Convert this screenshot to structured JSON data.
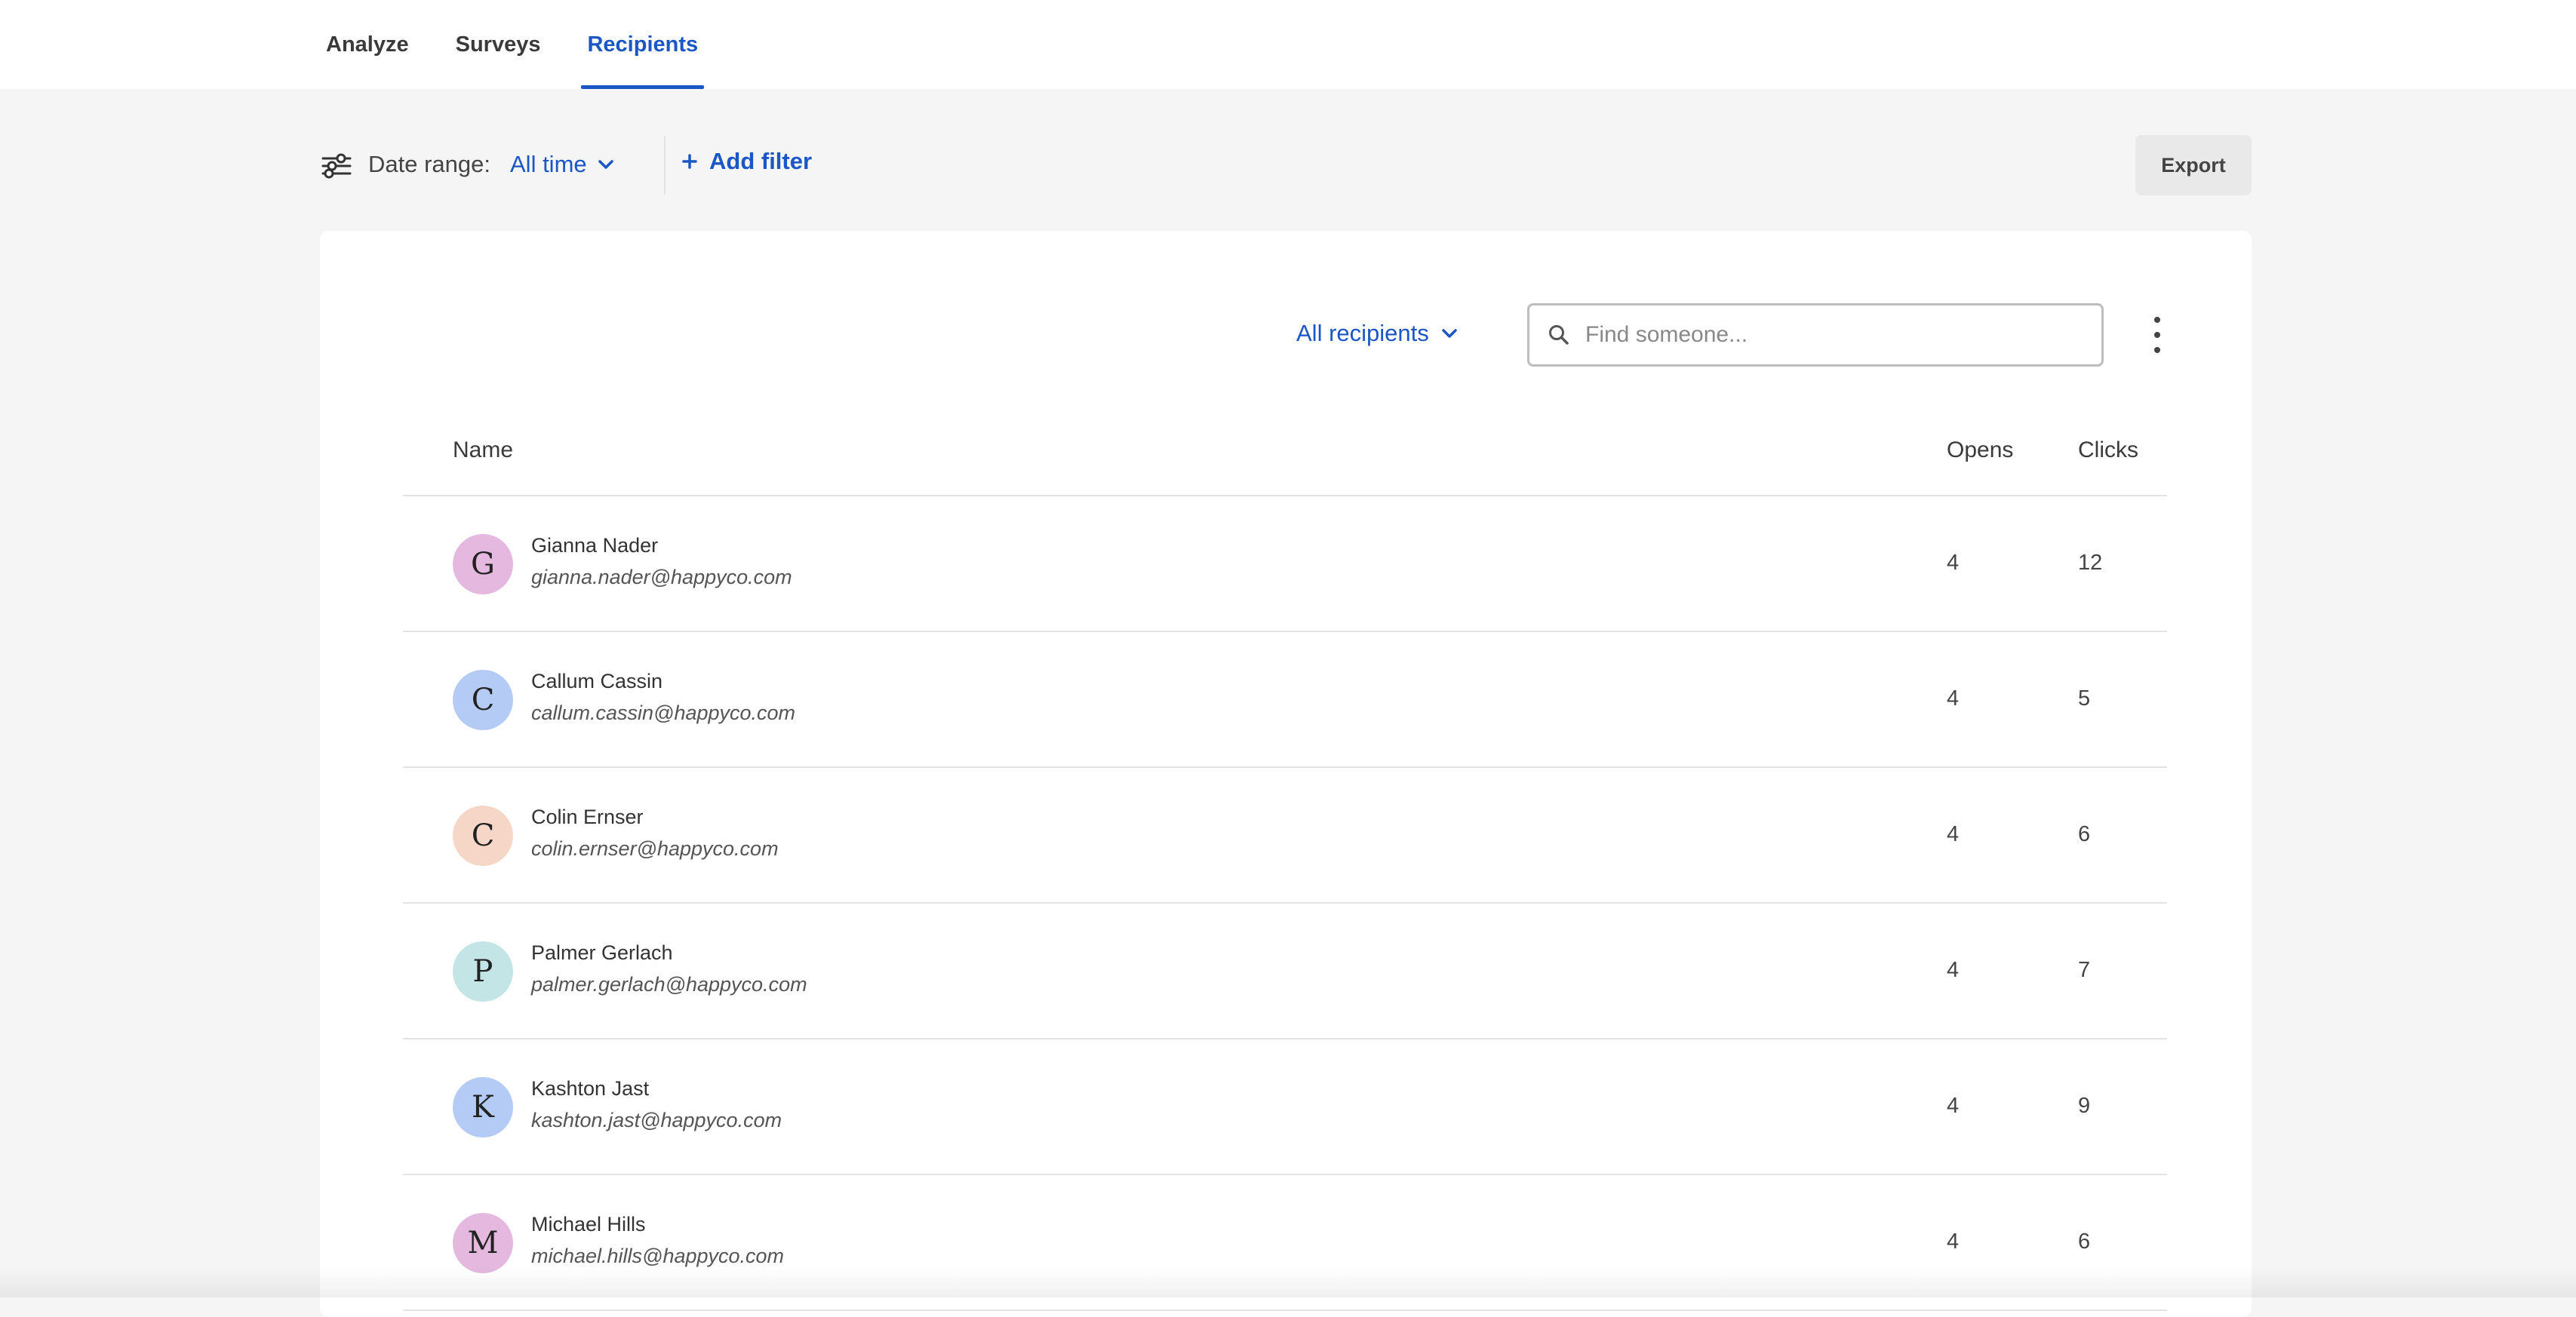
{
  "nav": {
    "tabs": [
      {
        "label": "Analyze"
      },
      {
        "label": "Surveys"
      },
      {
        "label": "Recipients"
      }
    ],
    "active_tab": "Recipients"
  },
  "filters": {
    "filter_icon": "sliders-icon",
    "date_label": "Date range:",
    "date_value": "All time",
    "add_filter_label": "Add filter",
    "export_label": "Export"
  },
  "toolbar": {
    "recipients_dropdown": "All recipients",
    "search_placeholder": "Find someone...",
    "search_value": "",
    "more_icon": "kebab-menu-icon"
  },
  "table": {
    "columns": {
      "name": "Name",
      "opens": "Opens",
      "clicks": "Clicks"
    },
    "rows": [
      {
        "initial": "G",
        "avatar_color": "#e4b8df",
        "name": "Gianna Nader",
        "email": "gianna.nader@happyco.com",
        "opens": "4",
        "clicks": "12"
      },
      {
        "initial": "C",
        "avatar_color": "#b4cbf5",
        "name": "Callum Cassin",
        "email": "callum.cassin@happyco.com",
        "opens": "4",
        "clicks": "5"
      },
      {
        "initial": "C",
        "avatar_color": "#f6d7c7",
        "name": "Colin Ernser",
        "email": "colin.ernser@happyco.com",
        "opens": "4",
        "clicks": "6"
      },
      {
        "initial": "P",
        "avatar_color": "#c3e5e6",
        "name": "Palmer Gerlach",
        "email": "palmer.gerlach@happyco.com",
        "opens": "4",
        "clicks": "7"
      },
      {
        "initial": "K",
        "avatar_color": "#b4cbf5",
        "name": "Kashton Jast",
        "email": "kashton.jast@happyco.com",
        "opens": "4",
        "clicks": "9"
      },
      {
        "initial": "M",
        "avatar_color": "#e4b8df",
        "name": "Michael Hills",
        "email": "michael.hills@happyco.com",
        "opens": "4",
        "clicks": "6"
      }
    ]
  },
  "colors": {
    "accent": "#1a56c4",
    "background": "#f5f5f5",
    "card": "#ffffff"
  }
}
